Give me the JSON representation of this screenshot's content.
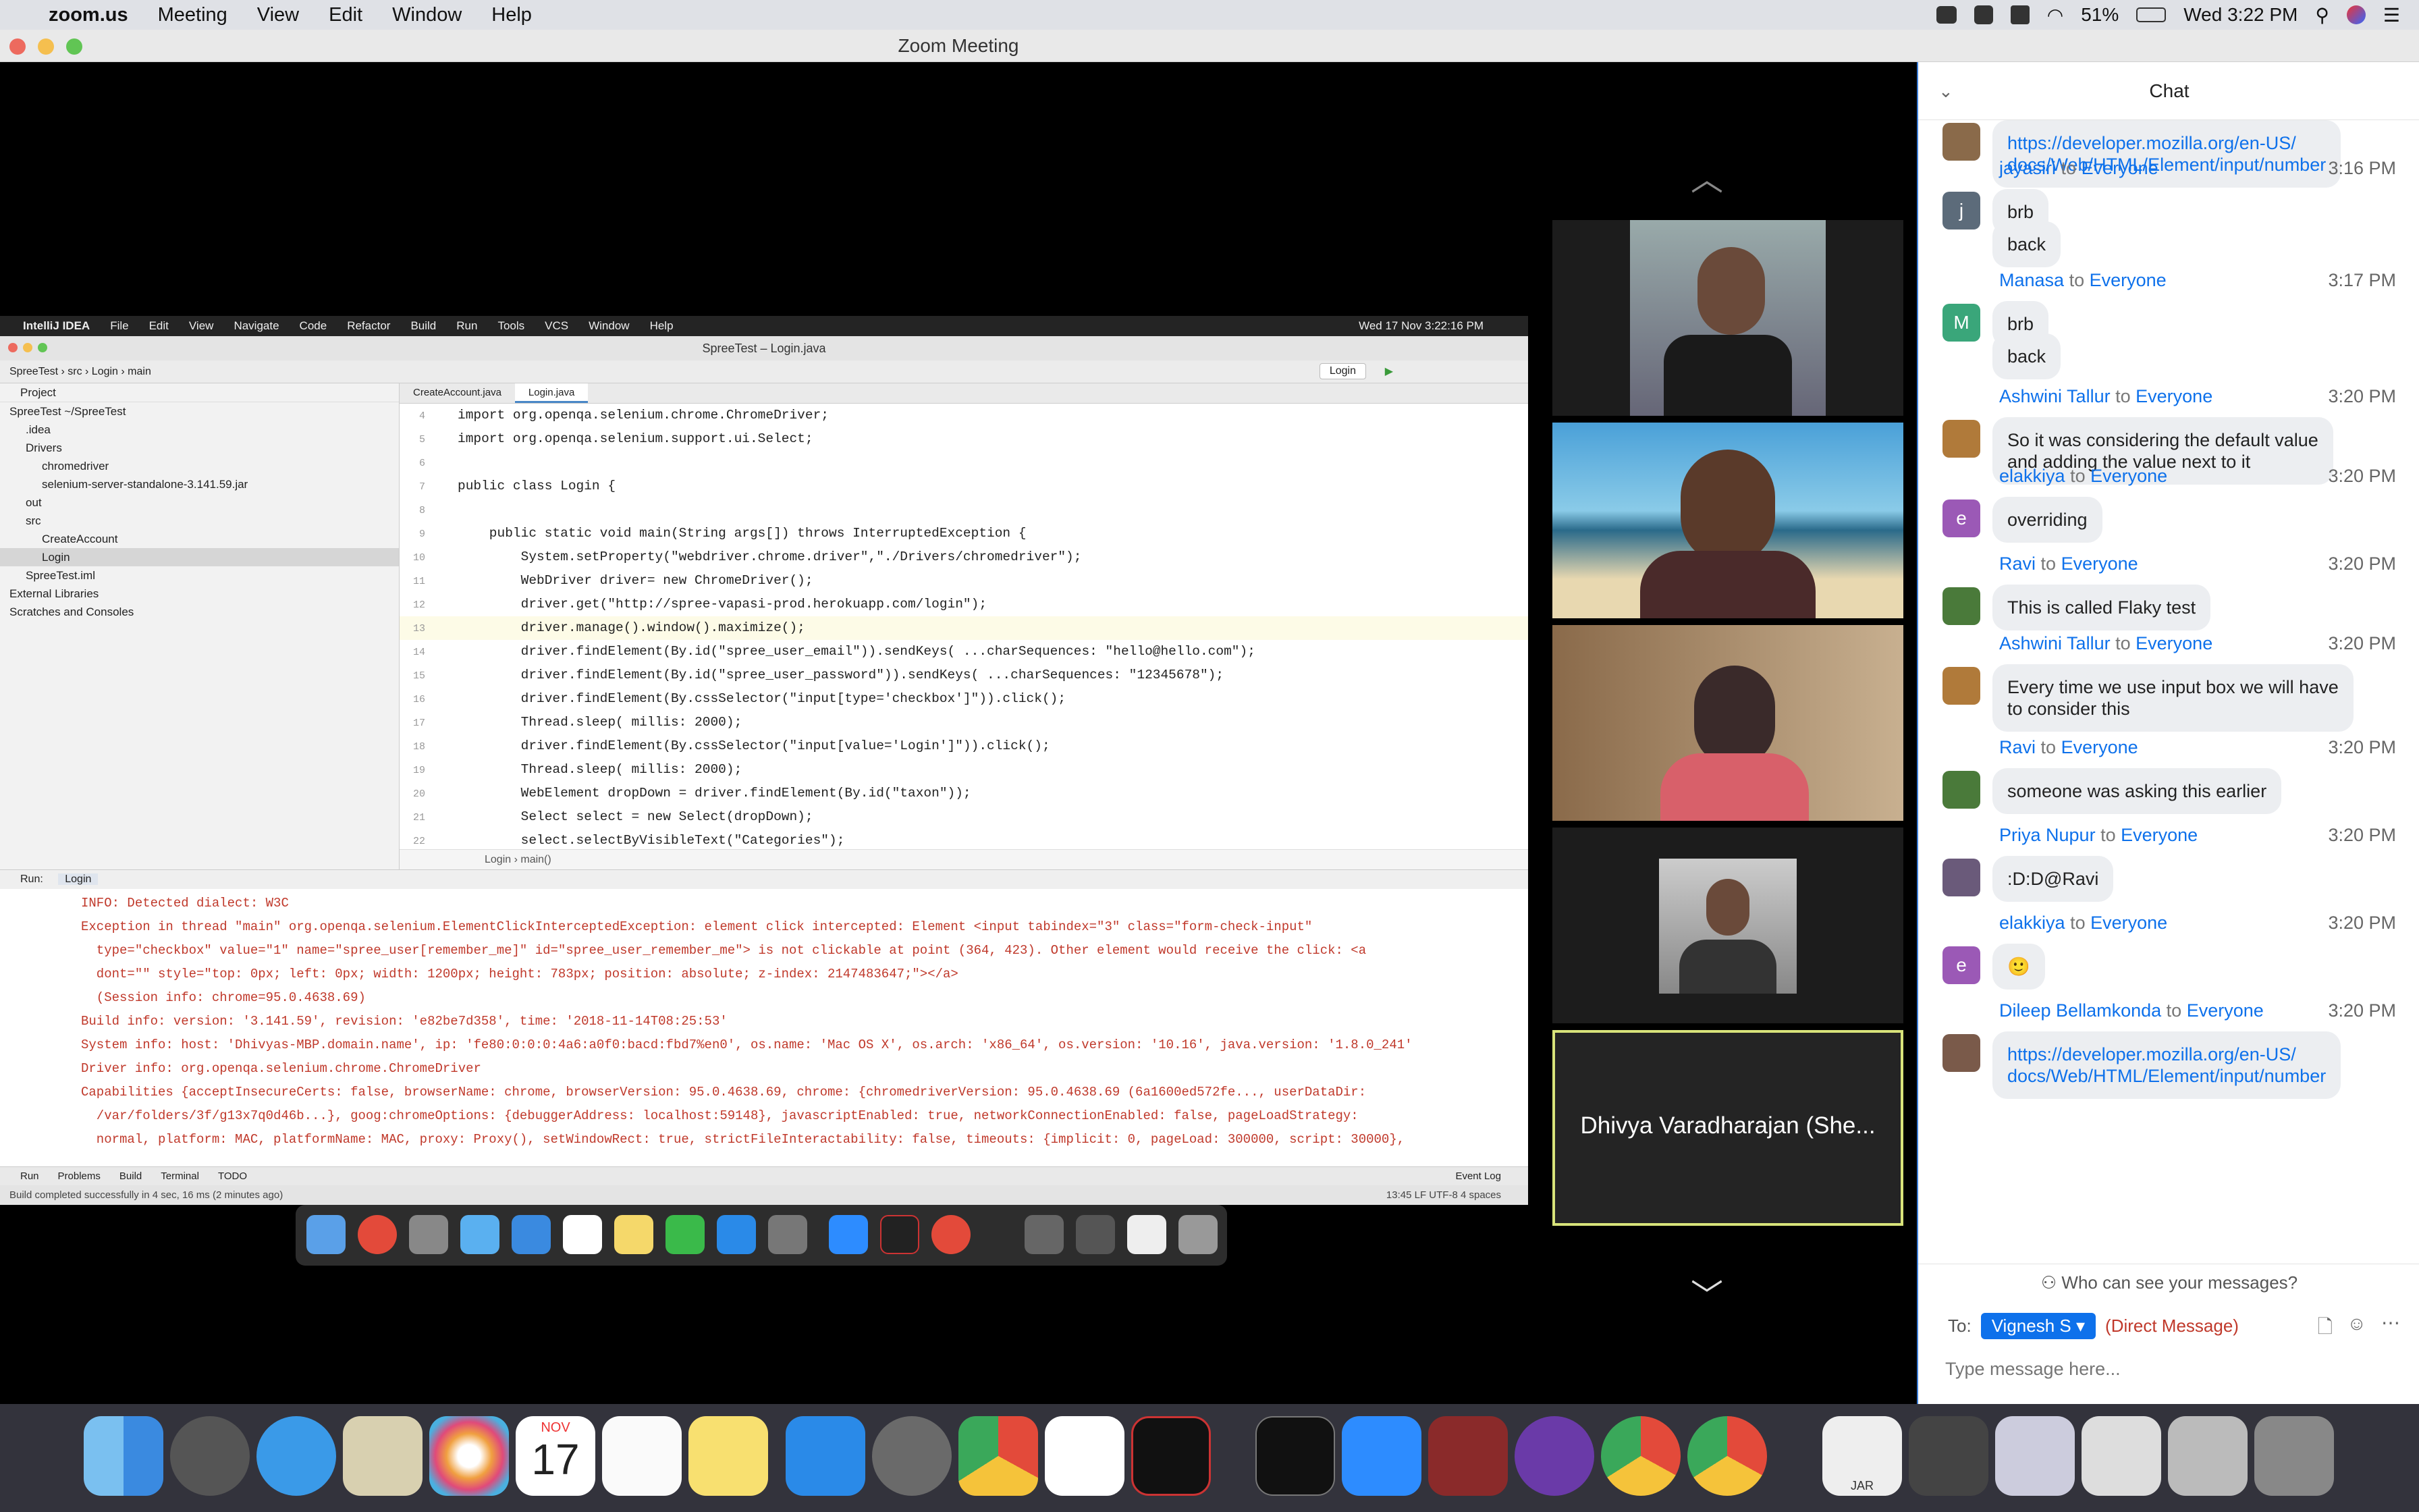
{
  "menubar": {
    "app": "zoom.us",
    "items": [
      "Meeting",
      "View",
      "Edit",
      "Window",
      "Help"
    ],
    "battery": "51%",
    "clock": "Wed 3:22 PM"
  },
  "window": {
    "title": "Zoom Meeting"
  },
  "ide": {
    "menu": [
      "IntelliJ IDEA",
      "File",
      "Edit",
      "View",
      "Navigate",
      "Code",
      "Refactor",
      "Build",
      "Run",
      "Tools",
      "VCS",
      "Window",
      "Help"
    ],
    "clock": "Wed 17 Nov  3:22:16 PM",
    "title": "SpreeTest – Login.java",
    "breadcrumb": "SpreeTest  ›  src  ›  Login  ›  main",
    "run_config": "Login",
    "project_label": "Project",
    "tree": [
      {
        "label": "SpreeTest ~/SpreeTest",
        "indent": 0
      },
      {
        "label": ".idea",
        "indent": 1
      },
      {
        "label": "Drivers",
        "indent": 1
      },
      {
        "label": "chromedriver",
        "indent": 2
      },
      {
        "label": "selenium-server-standalone-3.141.59.jar",
        "indent": 2
      },
      {
        "label": "out",
        "indent": 1
      },
      {
        "label": "src",
        "indent": 1
      },
      {
        "label": "CreateAccount",
        "indent": 2
      },
      {
        "label": "Login",
        "indent": 2
      },
      {
        "label": "SpreeTest.iml",
        "indent": 1
      },
      {
        "label": "External Libraries",
        "indent": 0
      },
      {
        "label": "Scratches and Consoles",
        "indent": 0
      }
    ],
    "tabs": [
      "CreateAccount.java",
      "Login.java"
    ],
    "code": [
      {
        "n": "4",
        "t": "import org.openqa.selenium.chrome.ChromeDriver;"
      },
      {
        "n": "5",
        "t": "import org.openqa.selenium.support.ui.Select;"
      },
      {
        "n": "6",
        "t": ""
      },
      {
        "n": "7",
        "t": "public class Login {"
      },
      {
        "n": "8",
        "t": ""
      },
      {
        "n": "9",
        "t": "    public static void main(String args[]) throws InterruptedException {"
      },
      {
        "n": "10",
        "t": "        System.setProperty(\"webdriver.chrome.driver\",\"./Drivers/chromedriver\");"
      },
      {
        "n": "11",
        "t": "        WebDriver driver= new ChromeDriver();"
      },
      {
        "n": "12",
        "t": "        driver.get(\"http://spree-vapasi-prod.herokuapp.com/login\");"
      },
      {
        "n": "13",
        "t": "        driver.manage().window().maximize();"
      },
      {
        "n": "14",
        "t": "        driver.findElement(By.id(\"spree_user_email\")).sendKeys( ...charSequences: \"hello@hello.com\");"
      },
      {
        "n": "15",
        "t": "        driver.findElement(By.id(\"spree_user_password\")).sendKeys( ...charSequences: \"12345678\");"
      },
      {
        "n": "16",
        "t": "        driver.findElement(By.cssSelector(\"input[type='checkbox']\")).click();"
      },
      {
        "n": "17",
        "t": "        Thread.sleep( millis: 2000);"
      },
      {
        "n": "18",
        "t": "        driver.findElement(By.cssSelector(\"input[value='Login']\")).click();"
      },
      {
        "n": "19",
        "t": "        Thread.sleep( millis: 2000);"
      },
      {
        "n": "20",
        "t": "        WebElement dropDown = driver.findElement(By.id(\"taxon\"));"
      },
      {
        "n": "21",
        "t": "        Select select = new Select(dropDown);"
      },
      {
        "n": "22",
        "t": "        select.selectByVisibleText(\"Categories\");"
      }
    ],
    "editor_footer": "Login  ›  main()",
    "run_label": "Run:",
    "run_tab": "Login",
    "output": [
      "INFO: Detected dialect: W3C",
      "Exception in thread \"main\" org.openqa.selenium.ElementClickInterceptedException: element click intercepted: Element <input tabindex=\"3\" class=\"form-check-input\"",
      "  type=\"checkbox\" value=\"1\" name=\"spree_user[remember_me]\" id=\"spree_user_remember_me\"> is not clickable at point (364, 423). Other element would receive the click: <a",
      "  dont=\"\" style=\"top: 0px; left: 0px; width: 1200px; height: 783px; position: absolute; z-index: 2147483647;\"></a>",
      "  (Session info: chrome=95.0.4638.69)",
      "Build info: version: '3.141.59', revision: 'e82be7d358', time: '2018-11-14T08:25:53'",
      "System info: host: 'Dhivyas-MBP.domain.name', ip: 'fe80:0:0:0:4a6:a0f0:bacd:fbd7%en0', os.name: 'Mac OS X', os.arch: 'x86_64', os.version: '10.16', java.version: '1.8.0_241'",
      "Driver info: org.openqa.selenium.chrome.ChromeDriver",
      "Capabilities {acceptInsecureCerts: false, browserName: chrome, browserVersion: 95.0.4638.69, chrome: {chromedriverVersion: 95.0.4638.69 (6a1600ed572fe..., userDataDir:",
      "  /var/folders/3f/g13x7q0d46b...}, goog:chromeOptions: {debuggerAddress: localhost:59148}, javascriptEnabled: true, networkConnectionEnabled: false, pageLoadStrategy:",
      "  normal, platform: MAC, platformName: MAC, proxy: Proxy(), setWindowRect: true, strictFileInteractability: false, timeouts: {implicit: 0, pageLoad: 300000, script: 30000},"
    ],
    "toolwindows": [
      "Run",
      "Problems",
      "Build",
      "Terminal",
      "TODO",
      "Event Log"
    ],
    "status": "Build completed successfully in 4 sec, 16 ms (2 minutes ago)",
    "status_right": "13:45   LF   UTF-8   4 spaces"
  },
  "gallery": {
    "active_speaker": "Dhivya Varadharajan (She..."
  },
  "chat": {
    "title": "Chat",
    "messages": [
      {
        "sender": "",
        "to": "",
        "time": "",
        "text": "https://developer.mozilla.org/en-US/\ndocs/Web/HTML/Element/input/number",
        "avatar": "photo",
        "color": "#8a6a4a",
        "link": true
      },
      {
        "sender": "jayasiri",
        "to": "Everyone",
        "time": "3:16 PM",
        "text": "brb",
        "avatar": "j",
        "color": "#5c6b7a"
      },
      {
        "sender": "",
        "to": "",
        "time": "",
        "text": "back",
        "avatar": "",
        "color": ""
      },
      {
        "sender": "Manasa",
        "to": "Everyone",
        "time": "3:17 PM",
        "text": "brb",
        "avatar": "M",
        "color": "#3aa67a"
      },
      {
        "sender": "",
        "to": "",
        "time": "",
        "text": "back",
        "avatar": "",
        "color": ""
      },
      {
        "sender": "Ashwini Tallur",
        "to": "Everyone",
        "time": "3:20 PM",
        "text": "So it was considering the default value\nand adding the value next to it",
        "avatar": "photo",
        "color": "#b07a3a"
      },
      {
        "sender": "elakkiya",
        "to": "Everyone",
        "time": "3:20 PM",
        "text": "overriding",
        "avatar": "e",
        "color": "#9b59b6"
      },
      {
        "sender": "Ravi",
        "to": "Everyone",
        "time": "3:20 PM",
        "text": "This is called Flaky test",
        "avatar": "photo",
        "color": "#4a7a3a"
      },
      {
        "sender": "Ashwini Tallur",
        "to": "Everyone",
        "time": "3:20 PM",
        "text": "Every time we use input box we will have\nto consider this",
        "avatar": "photo",
        "color": "#b07a3a"
      },
      {
        "sender": "Ravi",
        "to": "Everyone",
        "time": "3:20 PM",
        "text": "someone was asking this earlier",
        "avatar": "photo",
        "color": "#4a7a3a"
      },
      {
        "sender": "Priya Nupur",
        "to": "Everyone",
        "time": "3:20 PM",
        "text": ":D:D@Ravi",
        "avatar": "photo",
        "color": "#6a5a7a"
      },
      {
        "sender": "elakkiya",
        "to": "Everyone",
        "time": "3:20 PM",
        "text": "🙂",
        "avatar": "e",
        "color": "#9b59b6"
      },
      {
        "sender": "Dileep Bellamkonda",
        "to": "Everyone",
        "time": "3:20 PM",
        "text": "https://developer.mozilla.org/en-US/\ndocs/Web/HTML/Element/input/number",
        "avatar": "photo",
        "color": "#7a5a4a",
        "link": true
      }
    ],
    "to_word": "to",
    "who_can_see": "Who can see your messages?",
    "to_label": "To:",
    "recipient": "Vignesh S",
    "direct": "(Direct Message)",
    "placeholder": "Type message here..."
  },
  "dock": {
    "calendar_month": "NOV",
    "calendar_day": "17",
    "jar_label": "JAR"
  }
}
